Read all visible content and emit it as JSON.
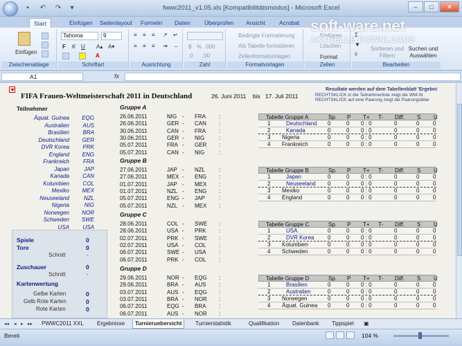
{
  "window": {
    "title": "fwwc2011_v1.05.xls [Kompatibilitätsmodus] - Microsoft Excel"
  },
  "ribbon_tabs": [
    "Start",
    "Einfügen",
    "Seitenlayout",
    "Formeln",
    "Daten",
    "Überprüfen",
    "Ansicht",
    "Acrobat"
  ],
  "ribbon": {
    "paste": "Einfügen",
    "clipboard": "Zwischenablage",
    "font": "Schriftart",
    "font_name": "Tahoma",
    "font_size": "9",
    "alignment": "Ausrichtung",
    "number": "Zahl",
    "styles": "Formatvorlagen",
    "cells": "Zellen",
    "editing": "Bearbeiten",
    "cond_format": "Bedingte Formatierung",
    "as_table": "Als Tabelle formatieren",
    "cell_styles": "Zellenformatvorlagen",
    "insert": "Einfügen",
    "delete": "Löschen",
    "format": "Format",
    "sort": "Sortieren und Filtern",
    "find": "Suchen und Auswählen"
  },
  "formula": {
    "cell": "A1",
    "fx": "fx",
    "value": ""
  },
  "watermark": {
    "line1": "soft-ware.net",
    "line2": "AKTUELLE DOWNLOADS"
  },
  "sheet": {
    "title": "FIFA Frauen-Weltmeisterschaft 2011  in Deutschland",
    "dates_from": "26. Juni 2011",
    "dates_bis": "bis",
    "dates_to": "17. Juli 2011",
    "note1": "Resultate werden auf dem Tabellenblatt 'Ergebni",
    "note2": "RECHTSKLICK in die Teilnehmerliste zeigt die WM-St",
    "note3": "RECHTSKLICK auf eine Paarung zeigt die Paarungsbilar",
    "teams_header": "Teilnehmer",
    "teams": [
      {
        "name": "Äquat. Guinea",
        "code": "EQG"
      },
      {
        "name": "Australien",
        "code": "AUS"
      },
      {
        "name": "Brasilien",
        "code": "BRA"
      },
      {
        "name": "Deutschland",
        "code": "GER"
      },
      {
        "name": "DVR Korea",
        "code": "PRK"
      },
      {
        "name": "England",
        "code": "ENG"
      },
      {
        "name": "Frankreich",
        "code": "FRA"
      },
      {
        "name": "Japan",
        "code": "JAP"
      },
      {
        "name": "Kanada",
        "code": "CAN"
      },
      {
        "name": "Kolumbien",
        "code": "COL"
      },
      {
        "name": "Mexiko",
        "code": "MEX"
      },
      {
        "name": "Neuseeland",
        "code": "NZL"
      },
      {
        "name": "Nigeria",
        "code": "NIG"
      },
      {
        "name": "Norwegen",
        "code": "NOR"
      },
      {
        "name": "Schweden",
        "code": "SWE"
      },
      {
        "name": "USA",
        "code": "USA"
      }
    ],
    "stats": {
      "spiele": "Spiele",
      "spiele_v": "0",
      "tore": "Tore",
      "tore_v": "0",
      "schnitt": "Schnitt",
      "schnitt_v": "-",
      "zuschauer": "Zuschauer",
      "zuschauer_v": "0",
      "schnitt2": "Schnitt",
      "schnitt2_v": "-",
      "karten": "Kartenwertung",
      "gelb": "Gelbe Karten",
      "gelb_v": "0",
      "gelbrot": "Gelb Rote Karten",
      "gelbrot_v": "0",
      "rot": "Rote Karten",
      "rot_v": "0"
    },
    "groups": [
      {
        "title": "Gruppe A",
        "matches": [
          {
            "d": "26.06.2011",
            "h": "NIG",
            "a": "FRA"
          },
          {
            "d": "26.06.2011",
            "h": "GER",
            "a": "CAN"
          },
          {
            "d": "30.06.2011",
            "h": "CAN",
            "a": "FRA"
          },
          {
            "d": "30.06.2011",
            "h": "GER",
            "a": "NIG"
          },
          {
            "d": "05.07.2011",
            "h": "FRA",
            "a": "GER"
          },
          {
            "d": "05.07.2011",
            "h": "CAN",
            "a": "NIG"
          }
        ],
        "table_title": "Tabelle Gruppe A",
        "teams": [
          "Deutschland",
          "Kanada",
          "Nigeria",
          "Frankreich"
        ]
      },
      {
        "title": "Gruppe B",
        "matches": [
          {
            "d": "27.06.2011",
            "h": "JAP",
            "a": "NZL"
          },
          {
            "d": "27.06.2011",
            "h": "MEX",
            "a": "ENG"
          },
          {
            "d": "01.07.2011",
            "h": "JAP",
            "a": "MEX"
          },
          {
            "d": "01.07.2011",
            "h": "NZL",
            "a": "ENG"
          },
          {
            "d": "05.07.2011",
            "h": "ENG",
            "a": "JAP"
          },
          {
            "d": "05.07.2011",
            "h": "NZL",
            "a": "MEX"
          }
        ],
        "table_title": "Tabelle Gruppe B",
        "teams": [
          "Japan",
          "Neuseeland",
          "Mexiko",
          "England"
        ]
      },
      {
        "title": "Gruppe C",
        "matches": [
          {
            "d": "28.06.2011",
            "h": "COL",
            "a": "SWE"
          },
          {
            "d": "28.06.2011",
            "h": "USA",
            "a": "PRK"
          },
          {
            "d": "02.07.2011",
            "h": "PRK",
            "a": "SWE"
          },
          {
            "d": "02.07.2011",
            "h": "USA",
            "a": "COL"
          },
          {
            "d": "06.07.2011",
            "h": "SWE",
            "a": "USA"
          },
          {
            "d": "06.07.2011",
            "h": "PRK",
            "a": "COL"
          }
        ],
        "table_title": "Tabelle Gruppe C",
        "teams": [
          "USA",
          "DVR Korea",
          "Kolumbien",
          "Schweden"
        ]
      },
      {
        "title": "Gruppe D",
        "matches": [
          {
            "d": "29.06.2011",
            "h": "NOR",
            "a": "EQG"
          },
          {
            "d": "29.06.2011",
            "h": "BRA",
            "a": "AUS"
          },
          {
            "d": "03.07.2011",
            "h": "AUS",
            "a": "EQG"
          },
          {
            "d": "03.07.2011",
            "h": "BRA",
            "a": "NOR"
          },
          {
            "d": "06.07.2011",
            "h": "EQG",
            "a": "BRA"
          },
          {
            "d": "06.07.2011",
            "h": "AUS",
            "a": "NOR"
          }
        ],
        "table_title": "Tabelle Gruppe D",
        "teams": [
          "Brasilien",
          "Australien",
          "Norwegen",
          "Äquat. Guinea"
        ]
      }
    ],
    "table_cols": [
      "Sp.",
      "P",
      "T+",
      "T-",
      "Diff.",
      "S",
      "U"
    ],
    "zero": "0",
    "colon": ":",
    "score": "0 : 0"
  },
  "sheet_tabs": [
    "PWWC2011 XXL",
    "Ergebnisse",
    "Turnieruebersicht",
    "Turnierstatistik",
    "Qualifikation",
    "Datenbank",
    "Tippspiel"
  ],
  "status": {
    "ready": "Bereit",
    "zoom": "104 %"
  }
}
